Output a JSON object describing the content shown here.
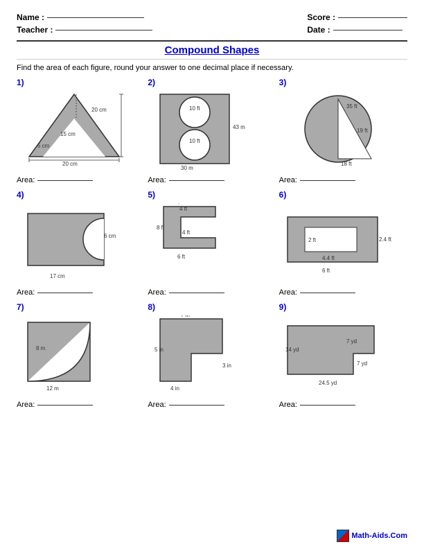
{
  "header": {
    "name_label": "Name :",
    "teacher_label": "Teacher :",
    "score_label": "Score :",
    "date_label": "Date :"
  },
  "title": "Compound Shapes",
  "instructions": "Find the area of each figure, round your answer to one decimal place if necessary.",
  "area_label": "Area:",
  "problems": [
    {
      "number": "1)"
    },
    {
      "number": "2)"
    },
    {
      "number": "3)"
    },
    {
      "number": "4)"
    },
    {
      "number": "5)"
    },
    {
      "number": "6)"
    },
    {
      "number": "7)"
    },
    {
      "number": "8)"
    },
    {
      "number": "9)"
    }
  ],
  "footer": {
    "logo_text": "Math-Aids.Com"
  }
}
